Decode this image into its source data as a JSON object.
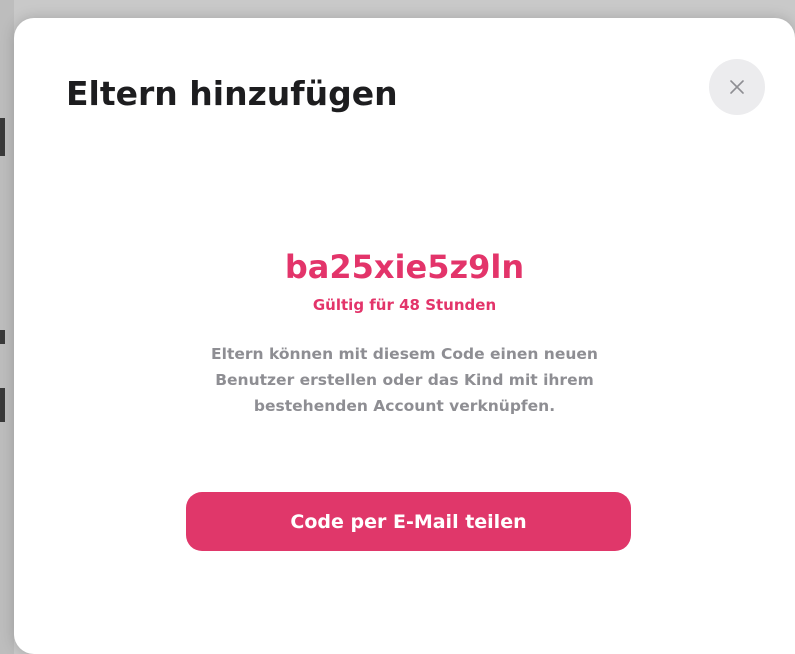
{
  "modal": {
    "title": "Eltern hinzufügen",
    "close_icon": "close-icon",
    "invite_code": "ba25xie5z9ln",
    "validity": "Gültig für 48 Stunden",
    "description": "Eltern können mit diesem Code einen neuen Benutzer erstellen oder das Kind mit ihrem bestehenden Account verknüpfen.",
    "share_button_label": "Code per E-Mail teilen"
  },
  "colors": {
    "accent": "#e0376a",
    "code_text": "#e3346a",
    "title_text": "#1d1d1f",
    "description_text": "#8e8e93",
    "close_button_bg": "#ececee"
  }
}
